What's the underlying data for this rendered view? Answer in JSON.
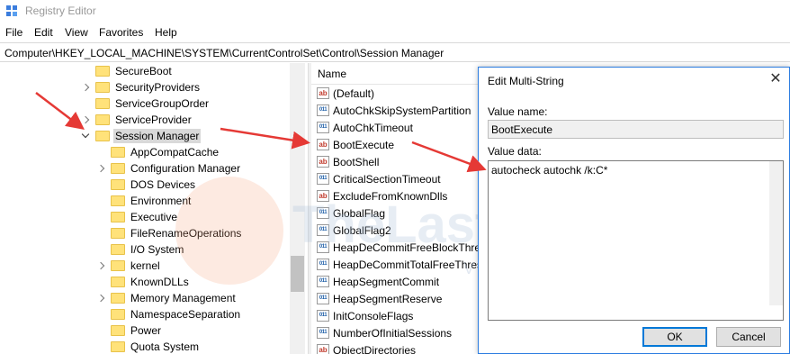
{
  "window": {
    "title": "Registry Editor"
  },
  "menu": [
    "File",
    "Edit",
    "View",
    "Favorites",
    "Help"
  ],
  "address": "Computer\\HKEY_LOCAL_MACHINE\\SYSTEM\\CurrentControlSet\\Control\\Session Manager",
  "tree": [
    {
      "label": "SecureBoot",
      "expanded": "no-children"
    },
    {
      "label": "SecurityProviders",
      "expanded": "collapsed"
    },
    {
      "label": "ServiceGroupOrder",
      "expanded": "no-children"
    },
    {
      "label": "ServiceProvider",
      "expanded": "collapsed"
    },
    {
      "label": "Session Manager",
      "expanded": "expanded",
      "selected": true
    },
    {
      "label": "AppCompatCache",
      "expanded": "no-children"
    },
    {
      "label": "Configuration Manager",
      "expanded": "collapsed"
    },
    {
      "label": "DOS Devices",
      "expanded": "no-children"
    },
    {
      "label": "Environment",
      "expanded": "no-children"
    },
    {
      "label": "Executive",
      "expanded": "no-children"
    },
    {
      "label": "FileRenameOperations",
      "expanded": "no-children"
    },
    {
      "label": "I/O System",
      "expanded": "no-children"
    },
    {
      "label": "kernel",
      "expanded": "collapsed"
    },
    {
      "label": "KnownDLLs",
      "expanded": "no-children"
    },
    {
      "label": "Memory Management",
      "expanded": "collapsed"
    },
    {
      "label": "NamespaceSeparation",
      "expanded": "no-children"
    },
    {
      "label": "Power",
      "expanded": "no-children"
    },
    {
      "label": "Quota System",
      "expanded": "no-children"
    }
  ],
  "list": {
    "column_name": "Name",
    "values": [
      {
        "name": "(Default)",
        "icon": "string-value-icon"
      },
      {
        "name": "AutoChkSkipSystemPartition",
        "icon": "binary-value-icon"
      },
      {
        "name": "AutoChkTimeout",
        "icon": "binary-value-icon"
      },
      {
        "name": "BootExecute",
        "icon": "string-value-icon"
      },
      {
        "name": "BootShell",
        "icon": "string-value-icon"
      },
      {
        "name": "CriticalSectionTimeout",
        "icon": "binary-value-icon"
      },
      {
        "name": "ExcludeFromKnownDlls",
        "icon": "string-value-icon"
      },
      {
        "name": "GlobalFlag",
        "icon": "binary-value-icon"
      },
      {
        "name": "GlobalFlag2",
        "icon": "binary-value-icon"
      },
      {
        "name": "HeapDeCommitFreeBlockThres",
        "icon": "binary-value-icon"
      },
      {
        "name": "HeapDeCommitTotalFreeThres",
        "icon": "binary-value-icon"
      },
      {
        "name": "HeapSegmentCommit",
        "icon": "binary-value-icon"
      },
      {
        "name": "HeapSegmentReserve",
        "icon": "binary-value-icon"
      },
      {
        "name": "InitConsoleFlags",
        "icon": "binary-value-icon"
      },
      {
        "name": "NumberOfInitialSessions",
        "icon": "binary-value-icon"
      },
      {
        "name": "ObjectDirectories",
        "icon": "string-value-icon"
      }
    ]
  },
  "dialog": {
    "title": "Edit Multi-String",
    "value_name_label": "Value name:",
    "value_name": "BootExecute",
    "value_data_label": "Value data:",
    "value_data": "autocheck autochk /k:C*",
    "ok_label": "OK",
    "cancel_label": "Cancel"
  },
  "watermark": {
    "text": "TheLast",
    "sub": "VORS"
  },
  "colors": {
    "arrow": "#e53935",
    "accent": "#0078d7",
    "folder": "#ffe27a"
  }
}
